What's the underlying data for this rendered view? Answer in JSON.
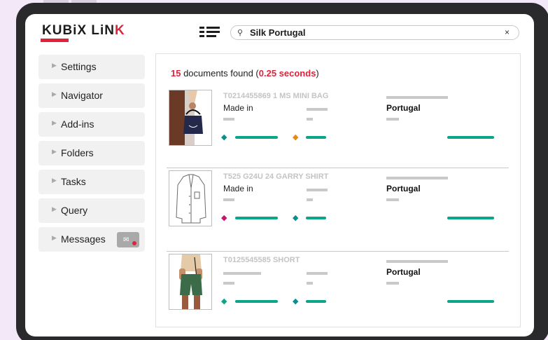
{
  "logo": {
    "part1": "KUBiX LiN",
    "part2": "K"
  },
  "search": {
    "value": "Silk Portugal",
    "clear": "×"
  },
  "sidebar": {
    "items": [
      {
        "label": "Settings"
      },
      {
        "label": "Navigator"
      },
      {
        "label": "Add-ins"
      },
      {
        "label": "Folders"
      },
      {
        "label": "Tasks"
      },
      {
        "label": "Query"
      },
      {
        "label": "Messages"
      }
    ]
  },
  "results": {
    "count": "15",
    "text": " documents found (",
    "time": "0.25 seconds",
    "close": ")"
  },
  "items": [
    {
      "title": "T0214455869 1 MS MINI BAG",
      "made_in": "Made in",
      "country": "Portugal"
    },
    {
      "title": "T525 G24U 24 GARRY SHIRT",
      "made_in": "Made in",
      "country": "Portugal"
    },
    {
      "title": "T0125545585 SHORT",
      "made_in": "",
      "country": "Portugal"
    }
  ],
  "colors": {
    "accent": "#e0223a",
    "green": "#0ba587",
    "tag_teal": "#0a8f8f",
    "tag_orange": "#e58a12",
    "tag_magenta": "#c8156b"
  }
}
